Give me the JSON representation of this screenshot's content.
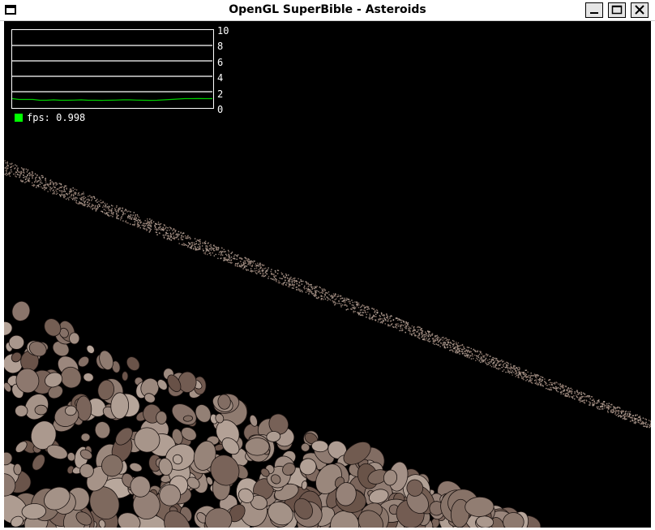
{
  "window": {
    "title": "OpenGL SuperBible - Asteroids",
    "buttons": {
      "minimize": "minimize",
      "maximize": "maximize",
      "close": "close"
    }
  },
  "fps_graph": {
    "y_ticks": [
      "10",
      "8",
      "6",
      "4",
      "2",
      "0"
    ],
    "series_color": "#00d000",
    "history": [
      1.1,
      1.0,
      1.0,
      1.0,
      0.9,
      0.9,
      0.95,
      0.9,
      0.9,
      0.92,
      0.95,
      0.9,
      0.9,
      0.88,
      0.9,
      0.92,
      0.95,
      0.95,
      0.92,
      0.9,
      0.88,
      0.9,
      0.95,
      1.0,
      1.05,
      1.1,
      1.1,
      1.12,
      1.1,
      1.1
    ]
  },
  "fps_readout": {
    "label": "fps:",
    "value": "0.998",
    "swatch_color": "#00ff00"
  },
  "colors": {
    "background": "#000000",
    "asteroid_light": "#b8a79c",
    "asteroid_dark": "#5a4238"
  }
}
